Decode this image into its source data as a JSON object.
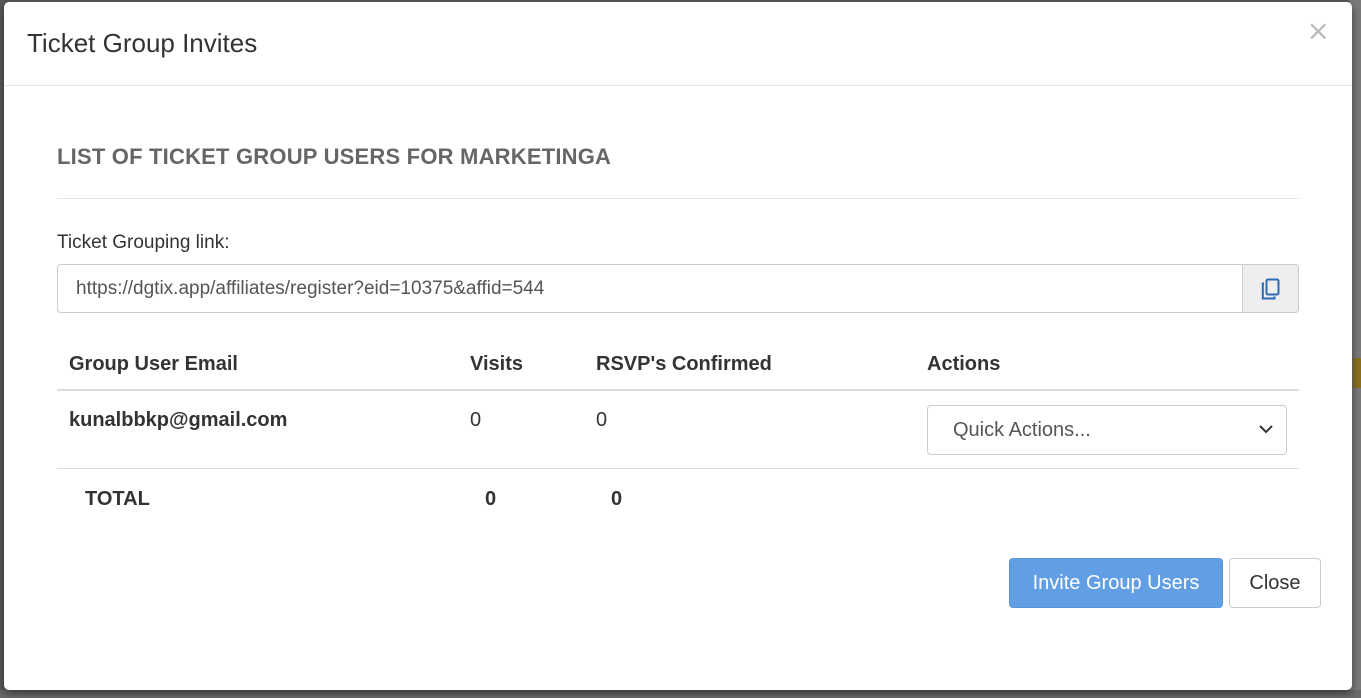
{
  "modal": {
    "title": "Ticket Group Invites",
    "close_symbol": "×"
  },
  "section": {
    "title": "LIST OF TICKET GROUP USERS FOR MARKETINGA"
  },
  "link": {
    "label": "Ticket Grouping link:",
    "value": "https://dgtix.app/affiliates/register?eid=10375&affid=544",
    "copy_icon": "copy-icon"
  },
  "table": {
    "headers": [
      "Group User Email",
      "Visits",
      "RSVP's Confirmed",
      "Actions"
    ],
    "rows": [
      {
        "email": "kunalbbkp@gmail.com",
        "visits": "0",
        "rsvps": "0",
        "action_select": "Quick Actions..."
      }
    ],
    "total": {
      "label": "TOTAL",
      "visits": "0",
      "rsvps": "0"
    }
  },
  "footer": {
    "invite_label": "Invite Group Users",
    "close_label": "Close"
  },
  "colors": {
    "primary": "#629ee4",
    "section_title": "#666666",
    "border": "#cccccc"
  }
}
